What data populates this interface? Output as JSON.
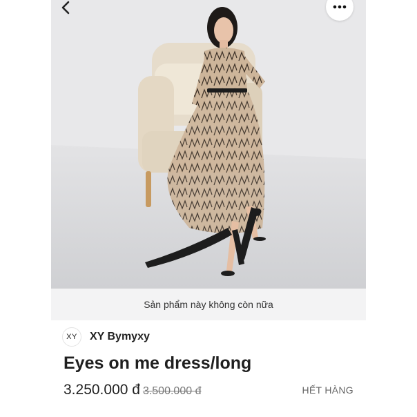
{
  "topbar": {
    "back_icon": "chevron-left-icon",
    "more_icon": "more-horizontal-icon"
  },
  "product_image": {
    "alt": "Product photo: woman in embroidered tulle dress seated on a beige armchair"
  },
  "notice": {
    "text": "Sản phẩm này không còn nữa"
  },
  "shop": {
    "logo_text": "XY",
    "name": "XY Bymyxy"
  },
  "product": {
    "title": "Eyes on me dress/long",
    "price": "3.250.000 đ",
    "old_price": "3.500.000 đ",
    "stock_status": "HẾT HÀNG"
  }
}
